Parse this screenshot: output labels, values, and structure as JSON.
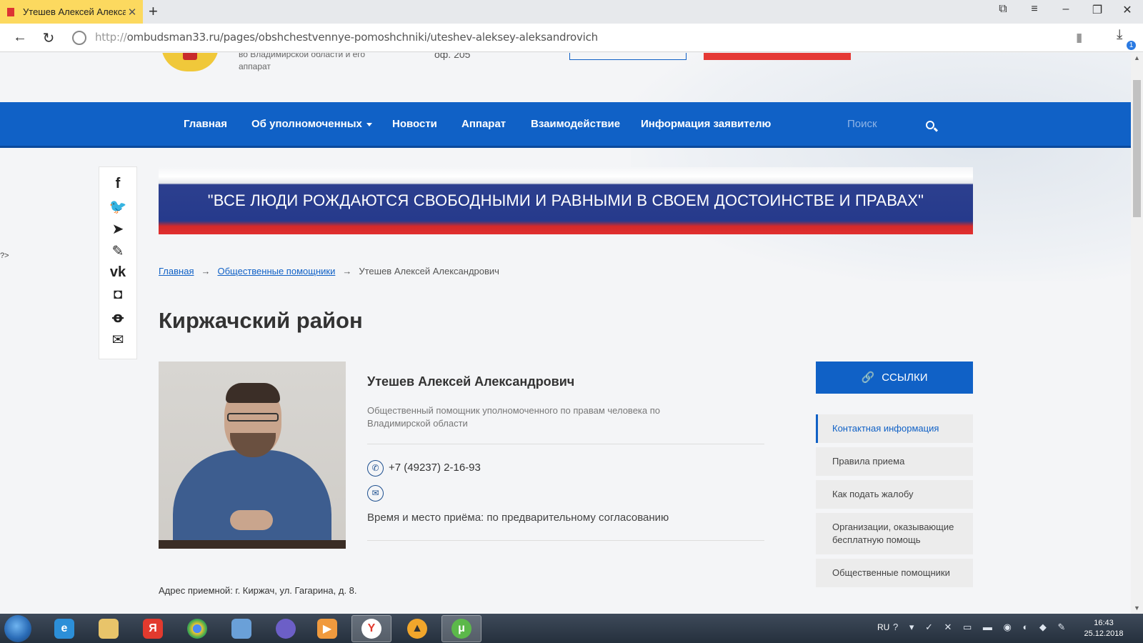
{
  "browser": {
    "tab_title": "Утешев Алексей Александрович",
    "url_scheme": "http://",
    "url_rest": "ombudsman33.ru/pages/obshchestvennye-pomoshchniki/uteshev-aleksey-aleksandrovich",
    "download_count": "1"
  },
  "header": {
    "org_text": "во Владимирской области и его аппарат",
    "office": "оф. 205"
  },
  "nav": {
    "items": [
      "Главная",
      "Об уполномоченных",
      "Новости",
      "Аппарат",
      "Взаимодействие",
      "Информация заявителю"
    ],
    "search_placeholder": "Поиск"
  },
  "share_icons": [
    "facebook-icon",
    "twitter-icon",
    "telegram-icon",
    "pencil-icon",
    "vk-icon",
    "instagram-icon",
    "odnoklassniki-icon",
    "email-icon"
  ],
  "banner": {
    "quote": "\"ВСЕ ЛЮДИ РОЖДАЮТСЯ СВОБОДНЫМИ И РАВНЫМИ В СВОЕМ ДОСТОИНСТВЕ И ПРАВАХ\""
  },
  "breadcrumb": {
    "home": "Главная",
    "section": "Общественные помощники",
    "current": "Утешев Алексей Александрович"
  },
  "page": {
    "title": "Киржачский район",
    "php_tag": "?>"
  },
  "person": {
    "name": "Утешев Алексей Александрович",
    "role": "Общественный помощник уполномоченного по правам человека по Владимирской области",
    "phone": "+7 (49237) 2-16-93",
    "reception": "Время и место приёма: по предварительному согласованию",
    "address": "Адрес приемной: г. Киржач, ул. Гагарина, д. 8."
  },
  "links": {
    "header": "ССЫЛКИ",
    "items": [
      "Контактная информация",
      "Правила приема",
      "Как подать жалобу",
      "Организации, оказывающие бесплатную помощь",
      "Общественные помощники"
    ],
    "active_index": 0
  },
  "taskbar": {
    "lang": "RU",
    "time": "16:43",
    "date": "25.12.2018"
  },
  "colors": {
    "primary_blue": "#1061c6",
    "tab_yellow": "#fcd95f",
    "red": "#e53935"
  }
}
